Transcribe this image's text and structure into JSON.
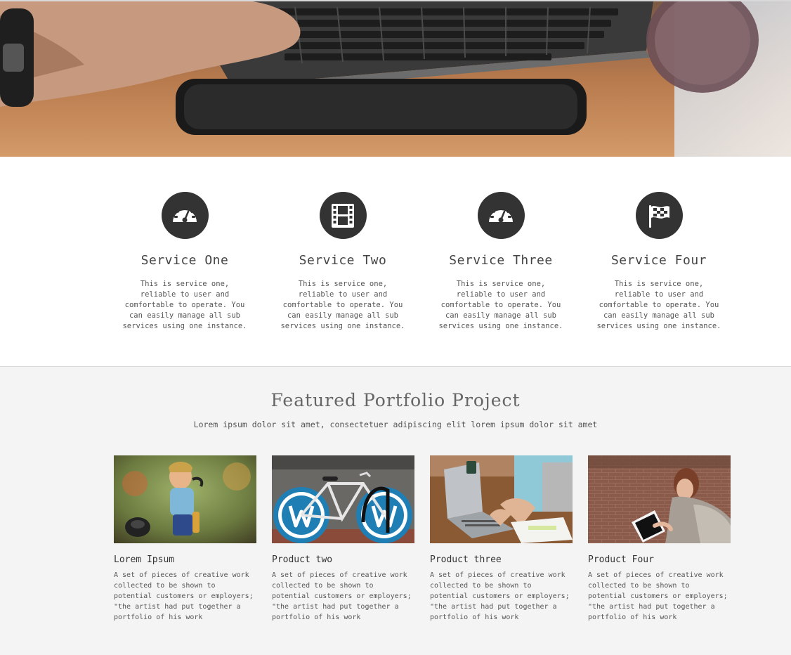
{
  "services": [
    {
      "icon": "dashboard-icon",
      "title": "Service One",
      "description": "This is service one, reliable to user and comfortable to operate. You can easily manage all sub services using one instance."
    },
    {
      "icon": "film-icon",
      "title": "Service Two",
      "description": "This is service one, reliable to user and comfortable to operate. You can easily manage all sub services using one instance."
    },
    {
      "icon": "dashboard-icon",
      "title": "Service Three",
      "description": "This is service one, reliable to user and comfortable to operate. You can easily manage all sub services using one instance."
    },
    {
      "icon": "flag-checkered-icon",
      "title": "Service Four",
      "description": "This is service one, reliable to user and comfortable to operate. You can easily manage all sub services using one instance."
    }
  ],
  "portfolio": {
    "title": "Featured Portfolio Project",
    "subtitle": "Lorem ipsum dolor sit amet, consectetuer adipiscing elit lorem ipsum dolor sit amet",
    "items": [
      {
        "title": "Lorem Ipsum",
        "description": "A set of pieces of creative work collected to be shown to potential customers or employers; \"the artist had put together a portfolio of his work"
      },
      {
        "title": "Product two",
        "description": "A set of pieces of creative work collected to be shown to potential customers or employers; \"the artist had put together a portfolio of his work"
      },
      {
        "title": "Product three",
        "description": "A set of pieces of creative work collected to be shown to potential customers or employers; \"the artist had put together a portfolio of his work"
      },
      {
        "title": "Product Four",
        "description": "A set of pieces of creative work collected to be shown to potential customers or employers; \"the artist had put together a portfolio of his work"
      }
    ]
  },
  "colors": {
    "icon_circle": "#333333",
    "services_bg": "#ffffff",
    "portfolio_bg": "#f4f4f4"
  }
}
